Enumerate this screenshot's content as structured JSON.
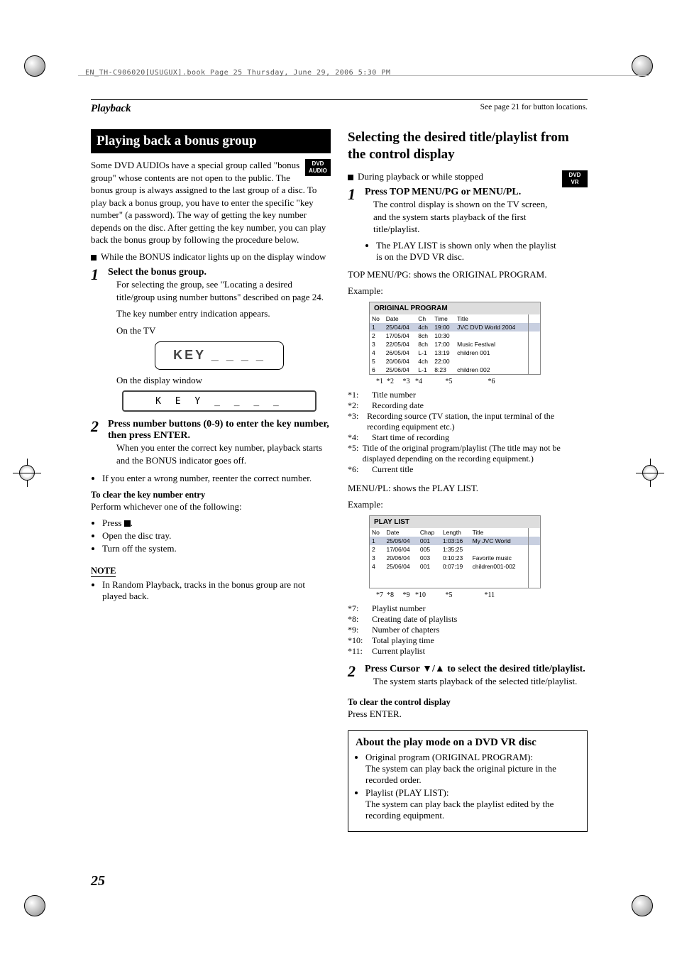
{
  "header_path": "EN_TH-C906020[USUGUX].book  Page 25  Thursday, June 29, 2006  5:30 PM",
  "section": "Playback",
  "see_note": "See page 21 for button locations.",
  "page_number": "25",
  "left": {
    "title": "Playing back a bonus group",
    "badge": "DVD AUDIO",
    "intro": "Some DVD AUDIOs have a special group called \"bonus group\" whose contents are not open to the public. The bonus group is always assigned to the last group of a disc. To play back a bonus group, you have to enter the specific \"key number\" (a password). The way of getting the key number depends on the disc. After getting the key number, you can play back the bonus group by following the procedure below.",
    "bullet_pre": "While the BONUS indicator lights up on the display window",
    "step1_head": "Select the bonus group.",
    "step1_body1": "For selecting the group, see \"Locating a desired title/group using number buttons\" described on page 24.",
    "step1_body2": "The key number entry indication appears.",
    "on_tv": "On the TV",
    "tv_text": "KEY _ _ _ _",
    "on_disp": "On the display window",
    "disp_text": "K E Y   _ _ _ _",
    "step2_head": "Press number buttons (0-9) to enter the key number, then press ENTER.",
    "step2_body": "When you enter the correct key number, playback starts and the BONUS indicator goes off.",
    "wrong": "If you enter a wrong number, reenter the correct number.",
    "clear_title": "To clear the key number entry",
    "clear_intro": "Perform whichever one of the following:",
    "clear_items": [
      "Press ",
      "Open the disc tray.",
      "Turn off the system."
    ],
    "note_label": "NOTE",
    "note_body": "In Random Playback, tracks in the bonus group are not played back."
  },
  "right": {
    "title": "Selecting the desired title/playlist from the control display",
    "badge": "DVD VR",
    "pre": "During playback or while stopped",
    "step1_head": "Press TOP MENU/PG or MENU/PL.",
    "step1_body1": "The control display is shown on the TV screen, and the system starts playback of the first title/playlist.",
    "step1_body2": "The PLAY LIST is shown only when the playlist is on the DVD VR disc.",
    "top_label": "TOP MENU/PG: shows the ORIGINAL PROGRAM.",
    "example": "Example:",
    "orig_caption": "ORIGINAL PROGRAM",
    "orig_headers": [
      "No",
      "Date",
      "Ch",
      "Time",
      "Title"
    ],
    "orig_rows": [
      [
        "1",
        "25/04/04",
        "4ch",
        "19:00",
        "JVC DVD World 2004"
      ],
      [
        "2",
        "17/05/04",
        "8ch",
        "10:30",
        ""
      ],
      [
        "3",
        "22/05/04",
        "8ch",
        "17:00",
        "Music Festival"
      ],
      [
        "4",
        "26/05/04",
        "L-1",
        "13:19",
        "children 001"
      ],
      [
        "5",
        "20/06/04",
        "4ch",
        "22:00",
        ""
      ],
      [
        "6",
        "25/06/04",
        "L-1",
        "8:23",
        "children 002"
      ]
    ],
    "orig_anno": "*1   *2      *3    *4             *5                    *6",
    "orig_defs": [
      [
        "*1:",
        "Title number"
      ],
      [
        "*2:",
        "Recording date"
      ],
      [
        "*3:",
        "Recording source (TV station, the input terminal of the recording equipment etc.)"
      ],
      [
        "*4:",
        "Start time of recording"
      ],
      [
        "*5:",
        "Title of the original program/playlist (The title may not be displayed depending on the recording equipment.)"
      ],
      [
        "*6:",
        "Current title"
      ]
    ],
    "menu_label": "MENU/PL: shows the PLAY LIST.",
    "pl_caption": "PLAY LIST",
    "pl_headers": [
      "No",
      "Date",
      "Chap",
      "Length",
      "Title"
    ],
    "pl_rows": [
      [
        "1",
        "25/05/04",
        "001",
        "1:03:16",
        "My JVC World"
      ],
      [
        "2",
        "17/06/04",
        "005",
        "1:35:25",
        ""
      ],
      [
        "3",
        "20/06/04",
        "003",
        "0:10:23",
        "Favorite music"
      ],
      [
        "4",
        "25/06/04",
        "001",
        "0:07:19",
        "children001-002"
      ]
    ],
    "pl_anno": "*7   *8      *9   *10            *5                   *11",
    "pl_defs": [
      [
        "*7:",
        "Playlist number"
      ],
      [
        "*8:",
        "Creating date of playlists"
      ],
      [
        "*9:",
        "Number of chapters"
      ],
      [
        "*10:",
        "Total playing time"
      ],
      [
        "*11:",
        "Current playlist"
      ]
    ],
    "step2_head_a": "Press Cursor ",
    "step2_head_b": " to select the desired title/playlist.",
    "step2_body": "The system starts playback of the selected title/playlist.",
    "clear_title": "To clear the control display",
    "clear_body": "Press ENTER.",
    "about_title": "About the play mode on a DVD VR disc",
    "about_items": [
      "Original program (ORIGINAL PROGRAM):\nThe system can play back the original picture in the recorded order.",
      "Playlist (PLAY LIST):\nThe system can play back the playlist edited by the recording equipment."
    ]
  }
}
